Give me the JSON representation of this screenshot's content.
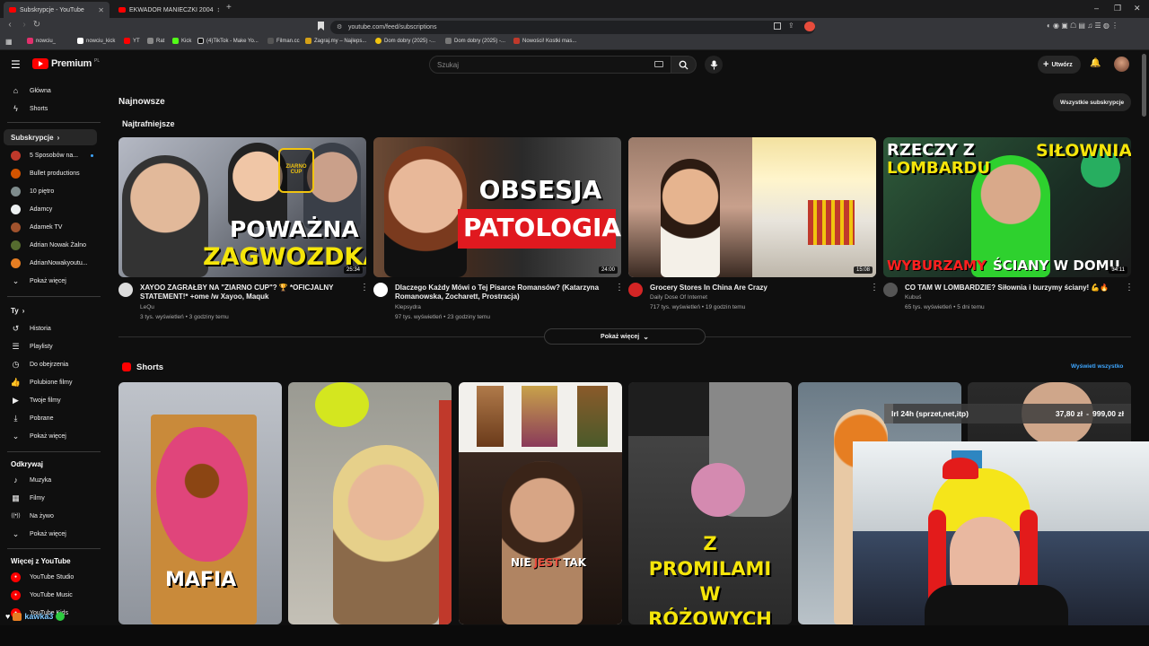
{
  "browser": {
    "tabs": [
      {
        "title": "Subskrypcje - YouTube",
        "close": "✕"
      },
      {
        "title": "EKWADOR MANIECZKI 2004",
        "close": "✕"
      }
    ],
    "new_tab": "+",
    "window_controls": [
      "–",
      "❐",
      "✕"
    ],
    "url": "youtube.com/feed/subscriptions",
    "bookmarks": [
      "nowciu_",
      "nowciu_kick",
      "YT",
      "Rat",
      "Kick",
      "(4)TikTok - Make Yo...",
      "Filman.cc",
      "Zagraj.my – Najleps...",
      "Dom dobry (2025) -...",
      "Dom dobry (2025) -...",
      "Nowości! Kostki mas..."
    ]
  },
  "header": {
    "logo_text": "Premium",
    "logo_region": "PL",
    "search_placeholder": "Szukaj",
    "create_label": "Utwórz"
  },
  "sidebar": {
    "main": [
      {
        "label": "Główna",
        "icon": "⌂"
      },
      {
        "label": "Shorts",
        "icon": "ϟ"
      }
    ],
    "subs_header": "Subskrypcje",
    "subs": [
      {
        "label": "5 Sposobów na...",
        "color": "#c0392b",
        "dot": true
      },
      {
        "label": "Bullet productions",
        "color": "#d35400",
        "dot": false
      },
      {
        "label": "10 piętro",
        "color": "#7f8c8d",
        "dot": false
      },
      {
        "label": "Adamcy",
        "color": "#ecf0f1",
        "dot": false
      },
      {
        "label": "Adamek TV",
        "color": "#a0522d",
        "dot": false
      },
      {
        "label": "Adrian Nowak Żalno",
        "color": "#556b2f",
        "dot": false
      },
      {
        "label": "AdrianNowakyoutu...",
        "color": "#e67e22",
        "dot": false
      }
    ],
    "subs_more": "Pokaż więcej",
    "you_header": "Ty",
    "you": [
      {
        "label": "Historia",
        "icon": "↺"
      },
      {
        "label": "Playlisty",
        "icon": "☰"
      },
      {
        "label": "Do obejrzenia",
        "icon": "◷"
      },
      {
        "label": "Polubione filmy",
        "icon": "👍"
      },
      {
        "label": "Twoje filmy",
        "icon": "▶"
      },
      {
        "label": "Pobrane",
        "icon": "⤓"
      }
    ],
    "you_more": "Pokaż więcej",
    "explore_header": "Odkrywaj",
    "explore": [
      {
        "label": "Muzyka",
        "icon": "♪"
      },
      {
        "label": "Filmy",
        "icon": "▦"
      },
      {
        "label": "Na żywo",
        "icon": "((•))"
      }
    ],
    "explore_more": "Pokaż więcej",
    "more_header": "Więcej z YouTube",
    "more": [
      {
        "label": "YouTube Studio"
      },
      {
        "label": "YouTube Music"
      },
      {
        "label": "YouTube Kids"
      }
    ]
  },
  "main": {
    "section_title": "Najnowsze",
    "all_subs_button": "Wszystkie subskrypcje",
    "subsection_title": "Najtrafniejsze",
    "videos": [
      {
        "title": "XAYOO ZAGRAŁBY NA \"ZIARNO CUP\"? 🏆 *OFICJALNY STATEMENT!* +ome /w Xayoo, Maquk",
        "channel": "LeQu",
        "meta": "3 tys. wyświetleń • 3 godziny temu",
        "duration": "25:34",
        "thumb_text_a": "POWAŻNA",
        "thumb_text_b": "ZAGWOZDKA",
        "badge": "ZIARNO CUP"
      },
      {
        "title": "Dlaczego Każdy Mówi o Tej Pisarce Romansów? (Katarzyna Romanowska, Zocharett, Prostracja)",
        "channel": "Klepsydra",
        "meta": "97 tys. wyświetleń • 23 godziny temu",
        "duration": "24:00",
        "thumb_text_a": "OBSESJA CZY",
        "thumb_text_b": "PATOLOGIA?"
      },
      {
        "title": "Grocery Stores In China Are Crazy",
        "channel": "Daily Dose Of Internet",
        "meta": "717 tys. wyświetleń • 19 godzin temu",
        "duration": "15:08"
      },
      {
        "title": "CO TAM W LOMBARDZIE? Siłownia i burzymy ściany! 💪🔥",
        "channel": "Kubuś",
        "meta": "65 tys. wyświetleń • 5 dni temu",
        "duration": "34:11",
        "thumb_text_a": "RZECZY Z",
        "thumb_text_b": "LOMBARDU",
        "thumb_text_c": "SIŁOWNIA",
        "thumb_text_d": "WYBURZAMY",
        "thumb_text_e": "ŚCIANY W DOMU"
      }
    ],
    "show_more": "Pokaż więcej",
    "shorts_title": "Shorts",
    "shorts_view_all": "Wyświetl wszystko",
    "shorts": [
      {
        "caption": "MAFIA"
      },
      {
        "caption": ""
      },
      {
        "caption_a": "NIE",
        "caption_b": "JEST",
        "caption_c": "TAK"
      },
      {
        "caption": "Z PROMILAMI W RÓŻOWYCH KLAPKACH"
      },
      {
        "caption": ""
      },
      {
        "caption": ""
      }
    ]
  },
  "stream_overlay": {
    "text": "lrl 24h (sprzet,net,itp)",
    "amount_current": "37,80 zł",
    "amount_goal": "999,00 zł",
    "progress_fraction": 0.038,
    "chat_name": "kawka3"
  },
  "colors": {
    "background": "#0f0f0f",
    "yt_red": "#ff0000",
    "link_blue": "#3ea6ff"
  }
}
